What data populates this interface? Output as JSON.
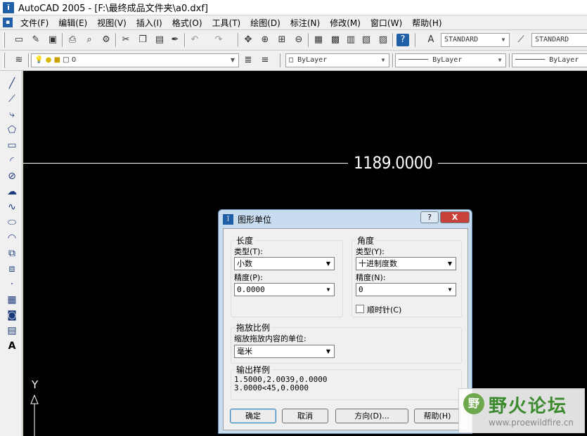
{
  "window": {
    "title": "AutoCAD 2005 - [F:\\最终成品文件夹\\a0.dxf]"
  },
  "menu": [
    "文件(F)",
    "编辑(E)",
    "视图(V)",
    "插入(I)",
    "格式(O)",
    "工具(T)",
    "绘图(D)",
    "标注(N)",
    "修改(M)",
    "窗口(W)",
    "帮助(H)"
  ],
  "toolbar": {
    "text_style": "STANDARD",
    "dim_style": "STANDARD",
    "layer": "0",
    "color": "ByLayer",
    "linetype": "ByLayer",
    "lineweight": "ByLayer"
  },
  "canvas": {
    "dimension_text": "1189.0000",
    "ucs_y": "Y"
  },
  "dialog": {
    "title": "图形单位",
    "help": "?",
    "close": "X",
    "length": {
      "group": "长度",
      "type_label": "类型(T):",
      "type_value": "小数",
      "precision_label": "精度(P):",
      "precision_value": "0.0000"
    },
    "angle": {
      "group": "角度",
      "type_label": "类型(Y):",
      "type_value": "十进制度数",
      "precision_label": "精度(N):",
      "precision_value": "0",
      "clockwise_label": "顺时针(C)"
    },
    "drag": {
      "group": "拖放比例",
      "label": "缩放拖放内容的单位:",
      "value": "毫米"
    },
    "output": {
      "group": "输出样例",
      "line1": "1.5000,2.0039,0.0000",
      "line2": "3.0000<45,0.0000"
    },
    "buttons": {
      "ok": "确定",
      "cancel": "取消",
      "direction": "方向(D)...",
      "help": "帮助(H)"
    }
  },
  "watermark": {
    "logo": "野",
    "text": "野火论坛",
    "url": "www.proewildfire.cn"
  }
}
